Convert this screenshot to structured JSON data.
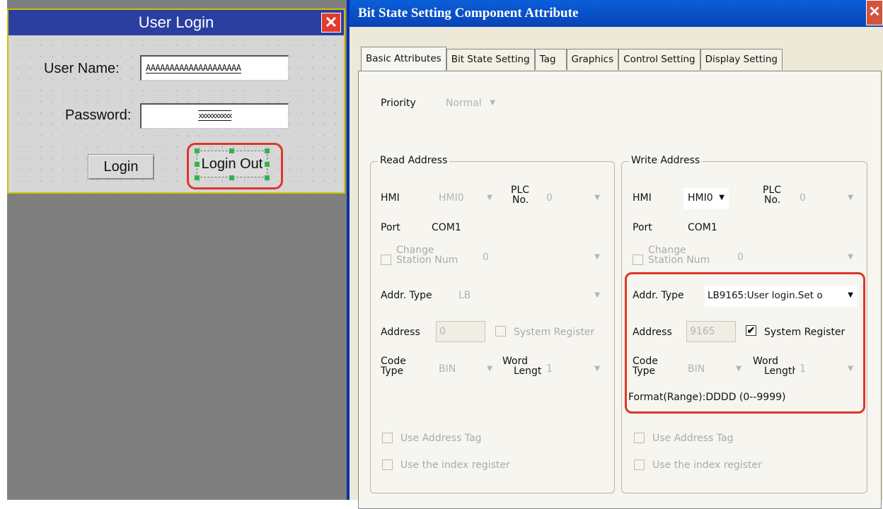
{
  "login_window": {
    "title": "User Login",
    "close_glyph": "✕",
    "username_label": "User Name:",
    "username_value": "AAAAAAAAAAAAAAAAAAAA",
    "password_label": "Password:",
    "password_value": "xxxxxxxxxx",
    "login_button": "Login",
    "login_out_button": "Login Out"
  },
  "dialog": {
    "title": "Bit State Setting Component Attribute",
    "close_glyph": "✕",
    "tabs": [
      "Basic Attributes",
      "Bit State Setting",
      "Tag",
      "Graphics",
      "Control Setting",
      "Display Setting"
    ],
    "active_tab": "Basic Attributes",
    "priority": {
      "label": "Priority",
      "value": "Normal"
    },
    "read_address": {
      "title": "Read Address",
      "hmi_label": "HMI",
      "hmi_value": "HMI0",
      "plc_no_label_1": "PLC",
      "plc_no_label_2": "No.",
      "plc_no_value": "0",
      "port_label": "Port",
      "port_value": "COM1",
      "change_station_1": "Change",
      "change_station_2": "Station Num",
      "station_value": "0",
      "addr_type_label": "Addr. Type",
      "addr_type_value": "LB",
      "address_label": "Address",
      "address_value": "0",
      "system_register": "System Register",
      "code_type_1": "Code",
      "code_type_2": "Type",
      "code_type_value": "BIN",
      "word_length_1": "Word",
      "word_length_2": "Length",
      "word_length_value": "1",
      "use_address_tag": "Use Address Tag",
      "use_index_register": "Use the index register"
    },
    "write_address": {
      "title": "Write Address",
      "hmi_label": "HMI",
      "hmi_value": "HMI0",
      "plc_no_label_1": "PLC",
      "plc_no_label_2": "No.",
      "plc_no_value": "0",
      "port_label": "Port",
      "port_value": "COM1",
      "change_station_1": "Change",
      "change_station_2": "Station Num",
      "station_value": "0",
      "addr_type_label": "Addr. Type",
      "addr_type_value": "LB9165:User login.Set o",
      "address_label": "Address",
      "address_value": "9165",
      "system_register": "System Register",
      "system_register_checked": true,
      "code_type_1": "Code",
      "code_type_2": "Type",
      "code_type_value": "BIN",
      "word_length_1": "Word",
      "word_length_2": "Length",
      "word_length_value": "1",
      "format": "Format(Range):DDDD (0--9999)",
      "use_address_tag": "Use Address Tag",
      "use_index_register": "Use the index register"
    },
    "dropdown_arrow": "▼",
    "check_glyph": "✔"
  },
  "colors": {
    "login_title_bg": "#2a3fa0",
    "dialog_title_bg": "#0a5fd8",
    "highlight": "#e0352b",
    "handles": "#33b54a",
    "workspace": "#7f7f7f"
  }
}
